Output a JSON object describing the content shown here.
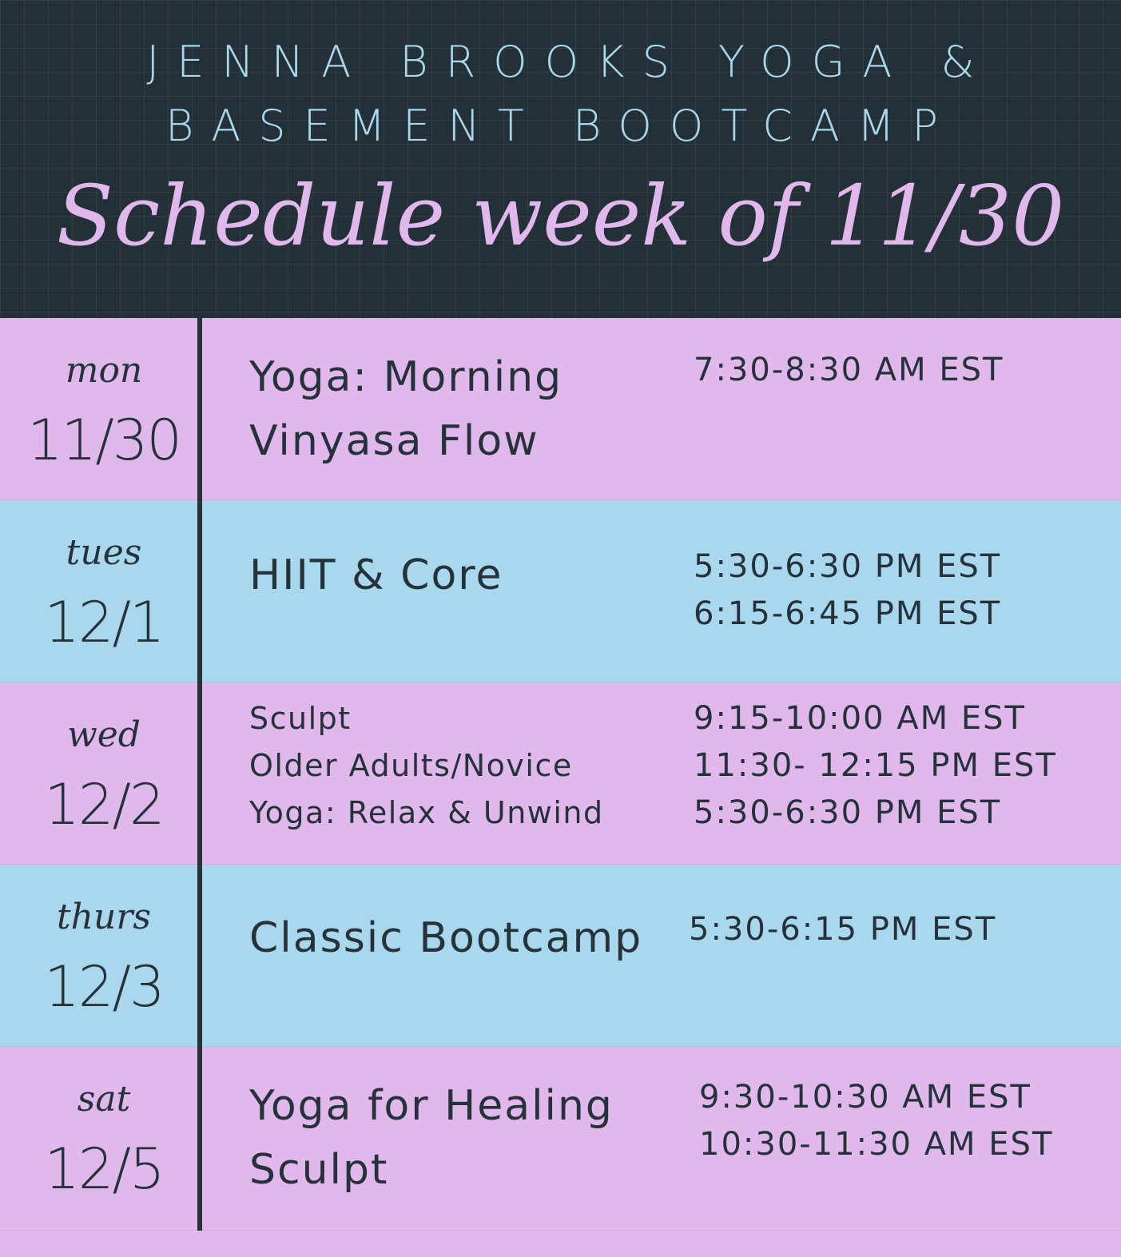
{
  "header": {
    "studio_name": "JENNA BROOKS YOGA & BASEMENT BOOTCAMP",
    "title": "Schedule week of 11/30"
  },
  "colors": {
    "header_bg": "#243038",
    "pink": "#e0b8ec",
    "blue": "#a9d8ee",
    "text": "#26323a"
  },
  "days": [
    {
      "day": "mon",
      "date": "11/30",
      "classes": [
        "Yoga: Morning",
        "Vinyasa Flow"
      ],
      "times": [
        "7:30-8:30 AM EST"
      ]
    },
    {
      "day": "tues",
      "date": "12/1",
      "classes": [
        "HIIT & Core"
      ],
      "times": [
        "5:30-6:30 PM EST",
        "6:15-6:45 PM EST"
      ]
    },
    {
      "day": "wed",
      "date": "12/2",
      "classes": [
        "Sculpt",
        "Older Adults/Novice",
        "Yoga: Relax & Unwind"
      ],
      "times": [
        "9:15-10:00 AM EST",
        "11:30- 12:15 PM EST",
        "5:30-6:30 PM EST"
      ]
    },
    {
      "day": "thurs",
      "date": "12/3",
      "classes": [
        "Classic Bootcamp"
      ],
      "times": [
        "5:30-6:15 PM EST"
      ]
    },
    {
      "day": "sat",
      "date": "12/5",
      "classes": [
        "Yoga for Healing",
        "Sculpt"
      ],
      "times": [
        "9:30-10:30 AM EST",
        "10:30-11:30 AM EST"
      ]
    }
  ]
}
